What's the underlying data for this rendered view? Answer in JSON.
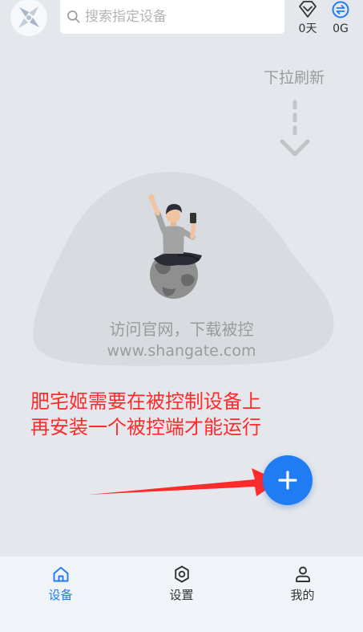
{
  "app": {
    "logo_icon": "app-logo-icon"
  },
  "search": {
    "placeholder": "搜索指定设备",
    "value": "",
    "icon": "search-icon"
  },
  "status": {
    "days": {
      "icon": "diamond-icon",
      "value": "0天"
    },
    "traffic": {
      "icon": "exchange-icon",
      "value": "0G"
    }
  },
  "pull_hint": {
    "label": "下拉刷新",
    "icon": "pull-down-arrow-icon"
  },
  "empty_state": {
    "illustration": "person-on-globe-illustration",
    "line1": "访问官网，下载被控",
    "line2": "www.shangate.com"
  },
  "annotation": {
    "line1": "肥宅姬需要在被控制设备上",
    "line2": "再安装一个被控端才能运行"
  },
  "fab": {
    "icon": "plus-icon"
  },
  "nav": {
    "items": [
      {
        "label": "设备",
        "icon": "home-icon",
        "active": true
      },
      {
        "label": "设置",
        "icon": "gear-icon",
        "active": false
      },
      {
        "label": "我的",
        "icon": "person-icon",
        "active": false
      }
    ]
  },
  "colors": {
    "accent": "#1f7cf2",
    "annotation": "#ff2b2b",
    "background": "#e4e7ec"
  }
}
